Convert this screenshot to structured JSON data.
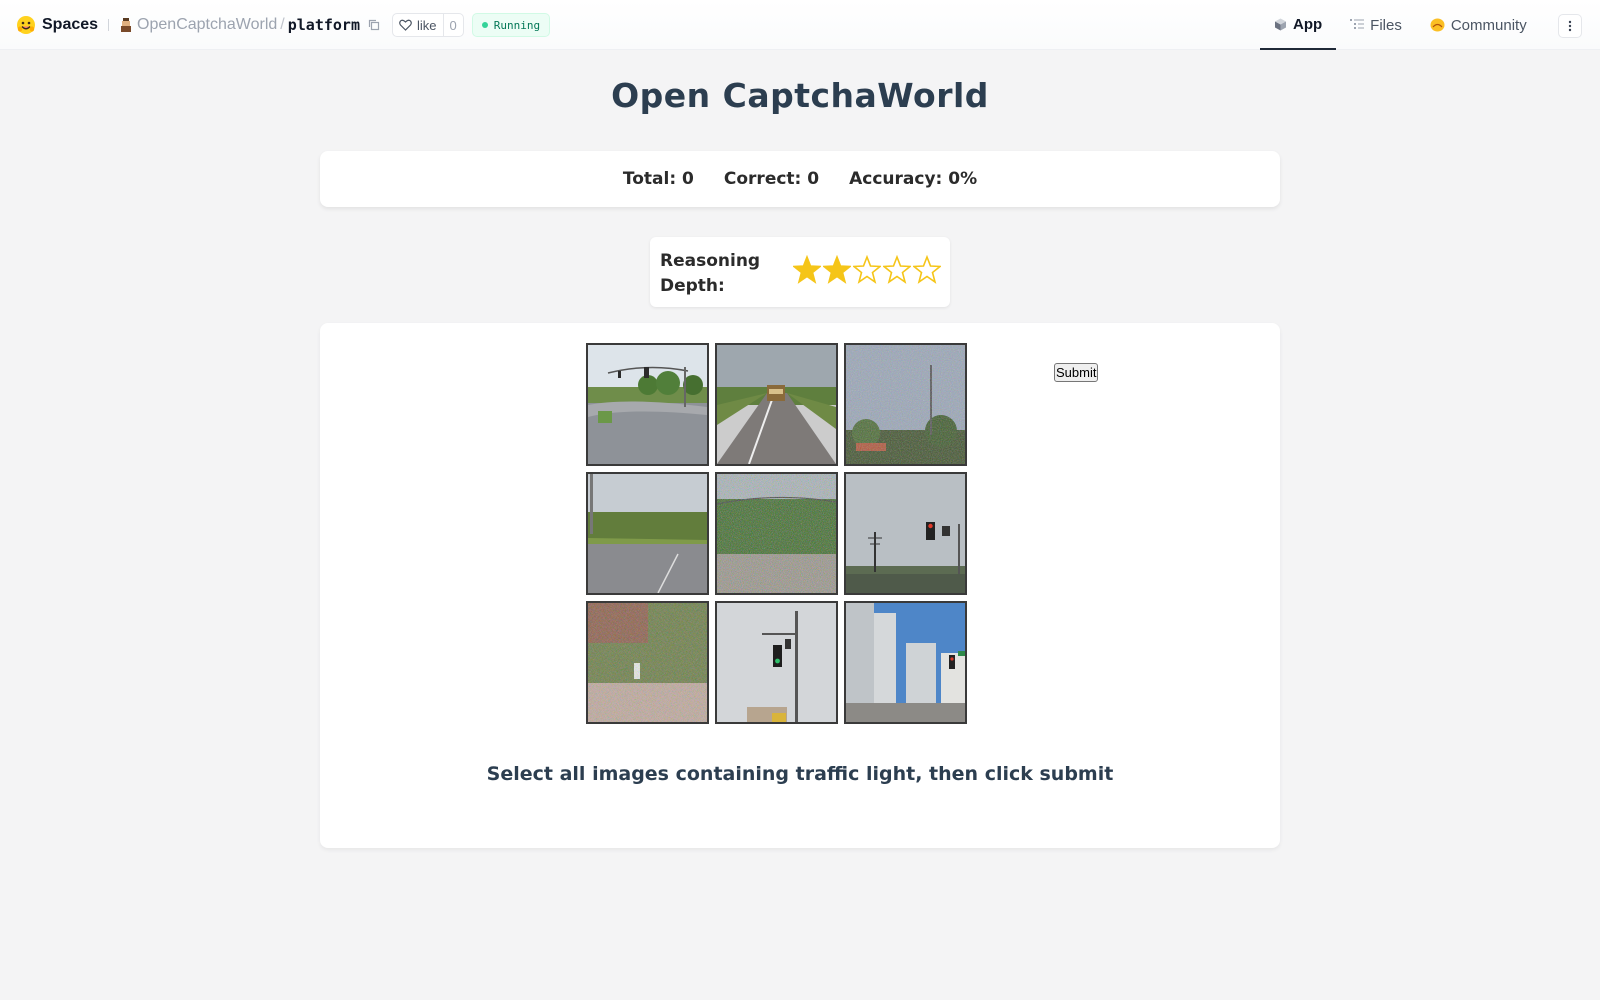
{
  "header": {
    "spaces_label": "Spaces",
    "owner": "OpenCaptchaWorld",
    "separator": "/",
    "repo": "platform",
    "like_label": "like",
    "like_count": "0",
    "status": "Running",
    "tabs": [
      {
        "label": "App",
        "icon": "cube-icon",
        "active": true
      },
      {
        "label": "Files",
        "icon": "files-icon",
        "active": false
      },
      {
        "label": "Community",
        "icon": "community-icon",
        "active": false
      }
    ]
  },
  "main": {
    "title": "Open CaptchaWorld",
    "stats": {
      "total": "Total: 0",
      "correct": "Correct: 0",
      "accuracy": "Accuracy: 0%"
    },
    "reasoning": {
      "label": "Reasoning Depth:",
      "rating": 2,
      "max": 5
    },
    "captcha": {
      "submit_label": "Submit",
      "instruction": "Select all images containing traffic light, then click submit",
      "tiles": [
        {
          "scene": "intersection with traffic light",
          "selected": false
        },
        {
          "scene": "highway with truck",
          "selected": false
        },
        {
          "scene": "noisy sky with trees",
          "selected": false
        },
        {
          "scene": "road with grass",
          "selected": false
        },
        {
          "scene": "noisy vegetation and road",
          "selected": false
        },
        {
          "scene": "overpass with traffic light",
          "selected": false
        },
        {
          "scene": "noisy bushes and sidewalk",
          "selected": false
        },
        {
          "scene": "traffic light on pole",
          "selected": false
        },
        {
          "scene": "city buildings with traffic light",
          "selected": false
        }
      ]
    }
  },
  "colors": {
    "background": "#f4f4f5",
    "title": "#2c3e50",
    "star_filled": "#f5c518",
    "running_bg": "#ecfdf5",
    "running_text": "#047857"
  }
}
